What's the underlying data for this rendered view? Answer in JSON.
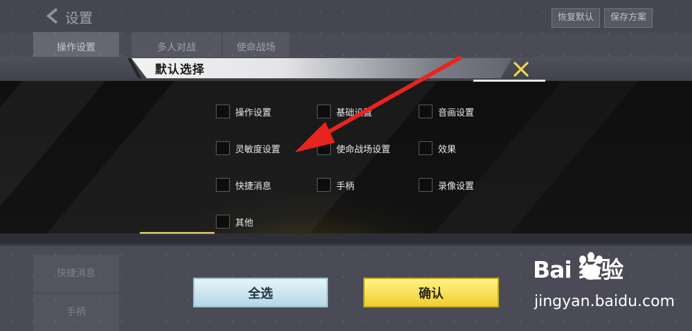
{
  "background": {
    "title": "设置",
    "buttons": [
      "恢复默认",
      "保存方案"
    ],
    "tabs": [
      "操作设置",
      "多人对战",
      "使命战场"
    ],
    "sidebar": [
      "快捷消息",
      "手柄"
    ]
  },
  "dialog": {
    "title": "默认选择",
    "options": [
      {
        "label": "操作设置",
        "checked": false
      },
      {
        "label": "基础设置",
        "checked": false
      },
      {
        "label": "音画设置",
        "checked": false
      },
      {
        "label": "灵敏度设置",
        "checked": false
      },
      {
        "label": "使命战场设置",
        "checked": false
      },
      {
        "label": "效果",
        "checked": false
      },
      {
        "label": "快捷消息",
        "checked": false
      },
      {
        "label": "手柄",
        "checked": false
      },
      {
        "label": "录像设置",
        "checked": false
      },
      {
        "label": "其他",
        "checked": false
      }
    ],
    "select_all_label": "全选",
    "confirm_label": "确认"
  },
  "watermark": {
    "logo_text": "Bai  经验",
    "url": "jingyan.baidu.com"
  },
  "annotation_arrow_color": "#e8241e",
  "icons": [
    "back-arrow-icon",
    "close-x-icon",
    "baidu-paw-icon"
  ]
}
